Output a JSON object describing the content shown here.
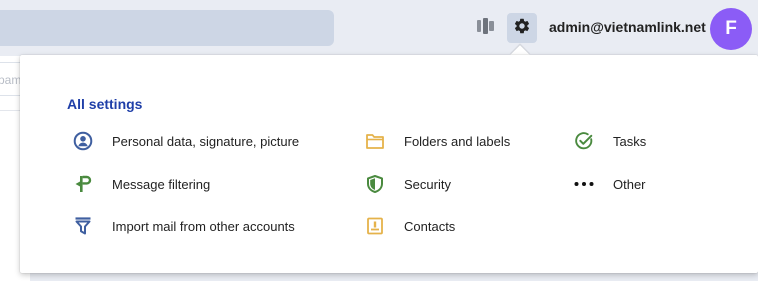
{
  "header": {
    "account_email": "admin@vietnamlink.net",
    "avatar_letter": "F",
    "avatar_color": "#8b5cf6"
  },
  "background": {
    "search_fragment": "pam"
  },
  "settings_menu": {
    "title": "All settings",
    "items": [
      {
        "label": "Personal data, signature, picture",
        "icon": "user-circle-icon"
      },
      {
        "label": "Message filtering",
        "icon": "filter-flag-icon"
      },
      {
        "label": "Import mail from other accounts",
        "icon": "funnel-import-icon"
      },
      {
        "label": "Folders and labels",
        "icon": "folder-icon"
      },
      {
        "label": "Security",
        "icon": "shield-icon"
      },
      {
        "label": "Contacts",
        "icon": "contacts-book-icon"
      },
      {
        "label": "Tasks",
        "icon": "check-circle-icon"
      },
      {
        "label": "Other",
        "icon": "more-dots-icon"
      }
    ]
  },
  "colors": {
    "accent": "#1f3fa8",
    "green": "#4a8a3f",
    "yellow": "#e5b24a",
    "blue": "#3f5fa0"
  }
}
